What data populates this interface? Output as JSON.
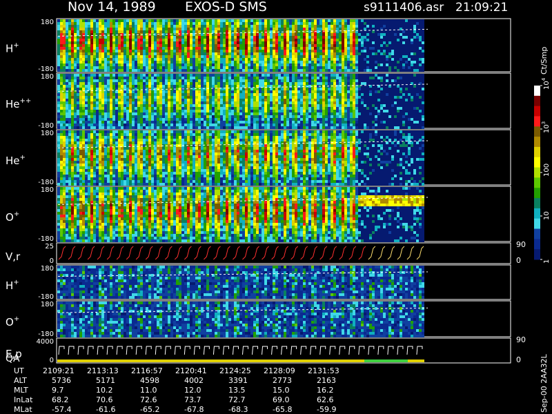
{
  "header": {
    "date": "Nov 14, 1989",
    "instrument": "EXOS-D SMS",
    "file": "s9111406.asr",
    "time": "21:09:21"
  },
  "side_labels": {
    "colorbar_unit": "Ct/Smp",
    "footer_code": "Sep-00 2AA32L"
  },
  "colorbar": {
    "ticks": [
      {
        "label": "10",
        "exp": "4",
        "frac": 0.0
      },
      {
        "label": "10",
        "exp": "3",
        "frac": 0.25
      },
      {
        "label": "100",
        "exp": "",
        "frac": 0.5
      },
      {
        "label": "10",
        "exp": "",
        "frac": 0.75
      },
      {
        "label": "1",
        "exp": "",
        "frac": 1.0
      }
    ],
    "colors": [
      "#ffffff",
      "#7a0000",
      "#c80000",
      "#ff1a1a",
      "#7a5a00",
      "#b08a00",
      "#e0d000",
      "#ffff00",
      "#b0e000",
      "#5cc800",
      "#22a000",
      "#0a8060",
      "#10b0c0",
      "#40d8e8",
      "#1040a0",
      "#0a2a90",
      "#061a70"
    ]
  },
  "chart_data": {
    "type": "heatmap",
    "panels": [
      {
        "id": "h-plus",
        "label": "H",
        "sup": "+",
        "ymax": "180",
        "ymin": "-180",
        "intensity": 1.0,
        "cutoff": 0.815
      },
      {
        "id": "he-plus-plus",
        "label": "He",
        "sup": "++",
        "ymax": "180",
        "ymin": "-180",
        "intensity": 0.7,
        "cutoff": 0.815
      },
      {
        "id": "he-plus",
        "label": "He",
        "sup": "+",
        "ymax": "180",
        "ymin": "-180",
        "intensity": 0.85,
        "cutoff": 0.815
      },
      {
        "id": "o-plus",
        "label": "O",
        "sup": "+",
        "ymax": "180",
        "ymin": "-180",
        "intensity": 0.95,
        "cutoff": 0.815
      },
      {
        "id": "vr",
        "label": "V,r",
        "sup": "",
        "ymax": "25",
        "ymin": "0",
        "right_tick": "90",
        "right_tick_low": "0"
      },
      {
        "id": "h-plus-lo",
        "label": "H",
        "sup": "+",
        "ymax": "180",
        "ymin": "-180",
        "intensity": 0.25,
        "cutoff": 1.0
      },
      {
        "id": "o-plus-lo",
        "label": "O",
        "sup": "+",
        "ymax": "180",
        "ymin": "-180",
        "intensity": 0.25,
        "cutoff": 1.0
      },
      {
        "id": "ep-qa",
        "label": "E,p",
        "label2": "QA",
        "sup": "",
        "ymax": "4000",
        "ymin": "0",
        "right_tick": "90",
        "right_tick_low": "0"
      }
    ],
    "x_table": {
      "rows": [
        {
          "name": "UT",
          "values": [
            "2109:21",
            "2113:13",
            "2116:57",
            "2120:41",
            "2124:25",
            "2128:09",
            "2131:53"
          ]
        },
        {
          "name": "ALT",
          "values": [
            "5736",
            "5171",
            "4598",
            "4002",
            "3391",
            "2773",
            "2163"
          ]
        },
        {
          "name": "MLT",
          "values": [
            "9.7",
            "10.2",
            "11.0",
            "12.0",
            "13.5",
            "15.0",
            "16.2"
          ]
        },
        {
          "name": "InLat",
          "values": [
            "68.2",
            "70.6",
            "72.6",
            "73.7",
            "72.7",
            "69.0",
            "62.6"
          ]
        },
        {
          "name": "MLat",
          "values": [
            "-57.4",
            "-61.6",
            "-65.2",
            "-67.8",
            "-68.3",
            "-65.8",
            "-59.9"
          ]
        }
      ]
    }
  }
}
